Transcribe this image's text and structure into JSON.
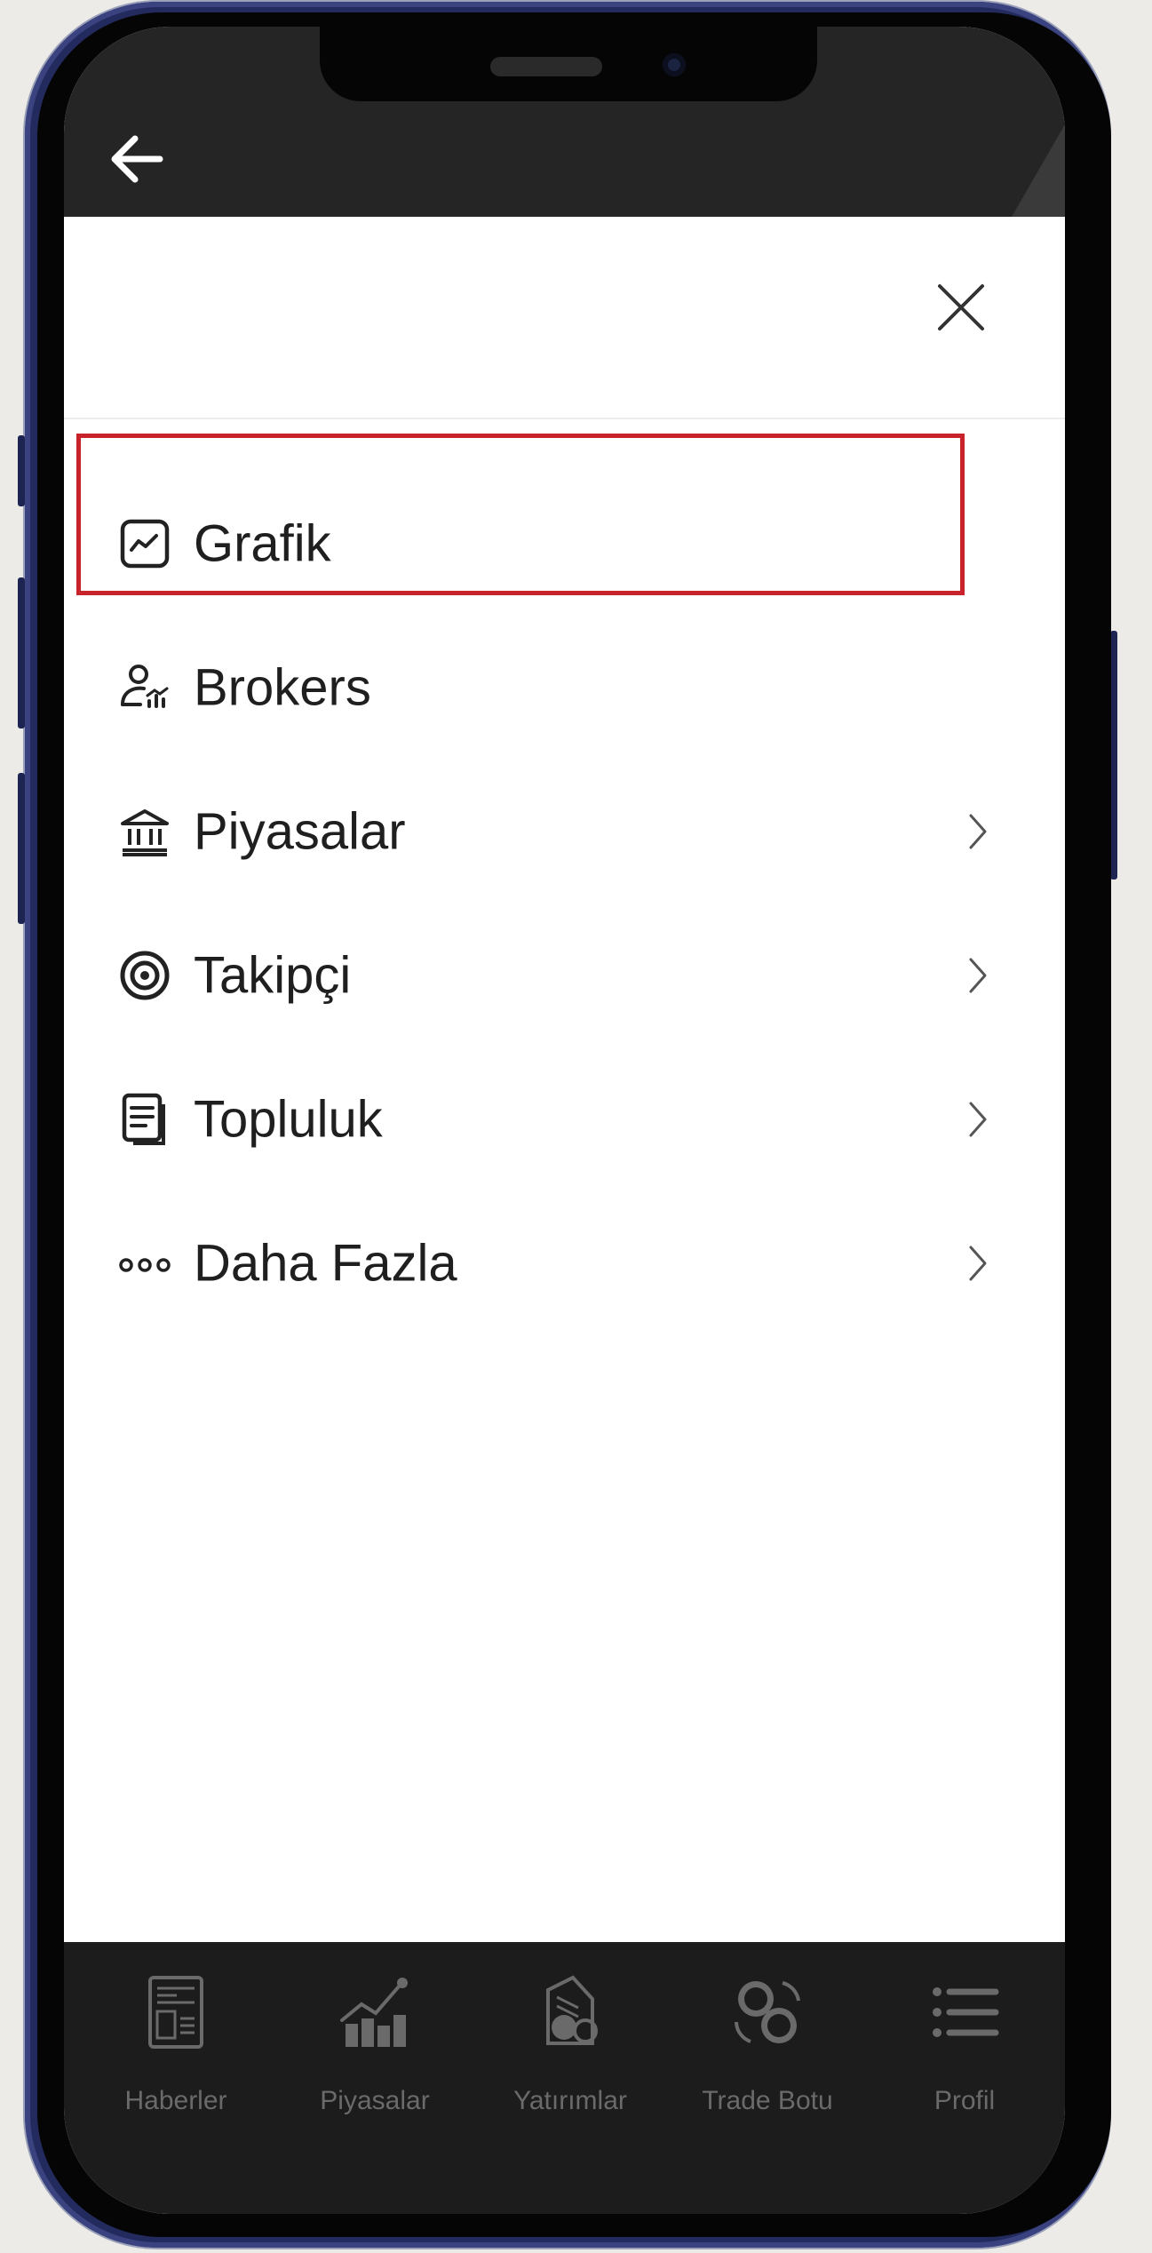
{
  "menu": {
    "items": [
      {
        "label": "Grafik",
        "icon": "chart-icon",
        "has_submenu": false,
        "highlighted": true
      },
      {
        "label": "Brokers",
        "icon": "brokers-icon",
        "has_submenu": false
      },
      {
        "label": "Piyasalar",
        "icon": "bank-icon",
        "has_submenu": true
      },
      {
        "label": "Takipçi",
        "icon": "target-icon",
        "has_submenu": true
      },
      {
        "label": "Topluluk",
        "icon": "document-icon",
        "has_submenu": true
      },
      {
        "label": "Daha Fazla",
        "icon": "more-dots-icon",
        "has_submenu": true
      }
    ]
  },
  "bottom_nav": {
    "items": [
      {
        "label": "Haberler",
        "icon": "newspaper-icon"
      },
      {
        "label": "Piyasalar",
        "icon": "market-growth-icon"
      },
      {
        "label": "Yatırımlar",
        "icon": "investments-icon"
      },
      {
        "label": "Trade Botu",
        "icon": "crypto-exchange-icon"
      },
      {
        "label": "Profil",
        "icon": "list-menu-icon"
      }
    ]
  },
  "colors": {
    "highlight_border": "#c8222a",
    "status_bar": "#252525",
    "bottom_nav_bg": "#1c1c1c",
    "phone_frame": "#232b5e"
  }
}
